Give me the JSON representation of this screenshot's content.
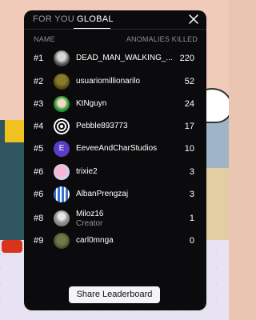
{
  "tabs": {
    "for_you": "FOR YOU",
    "global": "GLOBAL",
    "active": "GLOBAL"
  },
  "columns": {
    "name": "NAME",
    "kills": "ANOMALIES KILLED"
  },
  "rows": [
    {
      "rank": "#1",
      "name": "DEAD_MAN_WALKING_...",
      "score": "220",
      "avatar": "gray-portrait-avatar"
    },
    {
      "rank": "#2",
      "name": "usuariomillionarilo",
      "score": "52",
      "avatar": "olive-figure-avatar"
    },
    {
      "rank": "#3",
      "name": "KtNguyn",
      "score": "24",
      "avatar": "green-character-avatar"
    },
    {
      "rank": "#4",
      "name": "Pebble893773",
      "score": "17",
      "avatar": "pattern-avatar"
    },
    {
      "rank": "#5",
      "name": "EeveeAndCharStudios",
      "score": "10",
      "avatar": "letter-e-avatar",
      "initial": "E"
    },
    {
      "rank": "#6",
      "name": "trixie2",
      "score": "3",
      "avatar": "pink-pony-avatar"
    },
    {
      "rank": "#6",
      "name": "AlbanPrengzaj",
      "score": "3",
      "avatar": "blue-stripes-avatar"
    },
    {
      "rank": "#8",
      "name": "Miloz16",
      "subtitle": "Creator",
      "score": "1",
      "avatar": "gray-person-avatar"
    },
    {
      "rank": "#9",
      "name": "carl0mnga",
      "score": "0",
      "avatar": "dark-green-avatar"
    }
  ],
  "share_label": "Share Leaderboard",
  "colors": {
    "panel": "#0b0b0d",
    "muted": "#8f8f96",
    "letter_avatar": "#5b3cc4",
    "button": "#f4f4f6"
  }
}
